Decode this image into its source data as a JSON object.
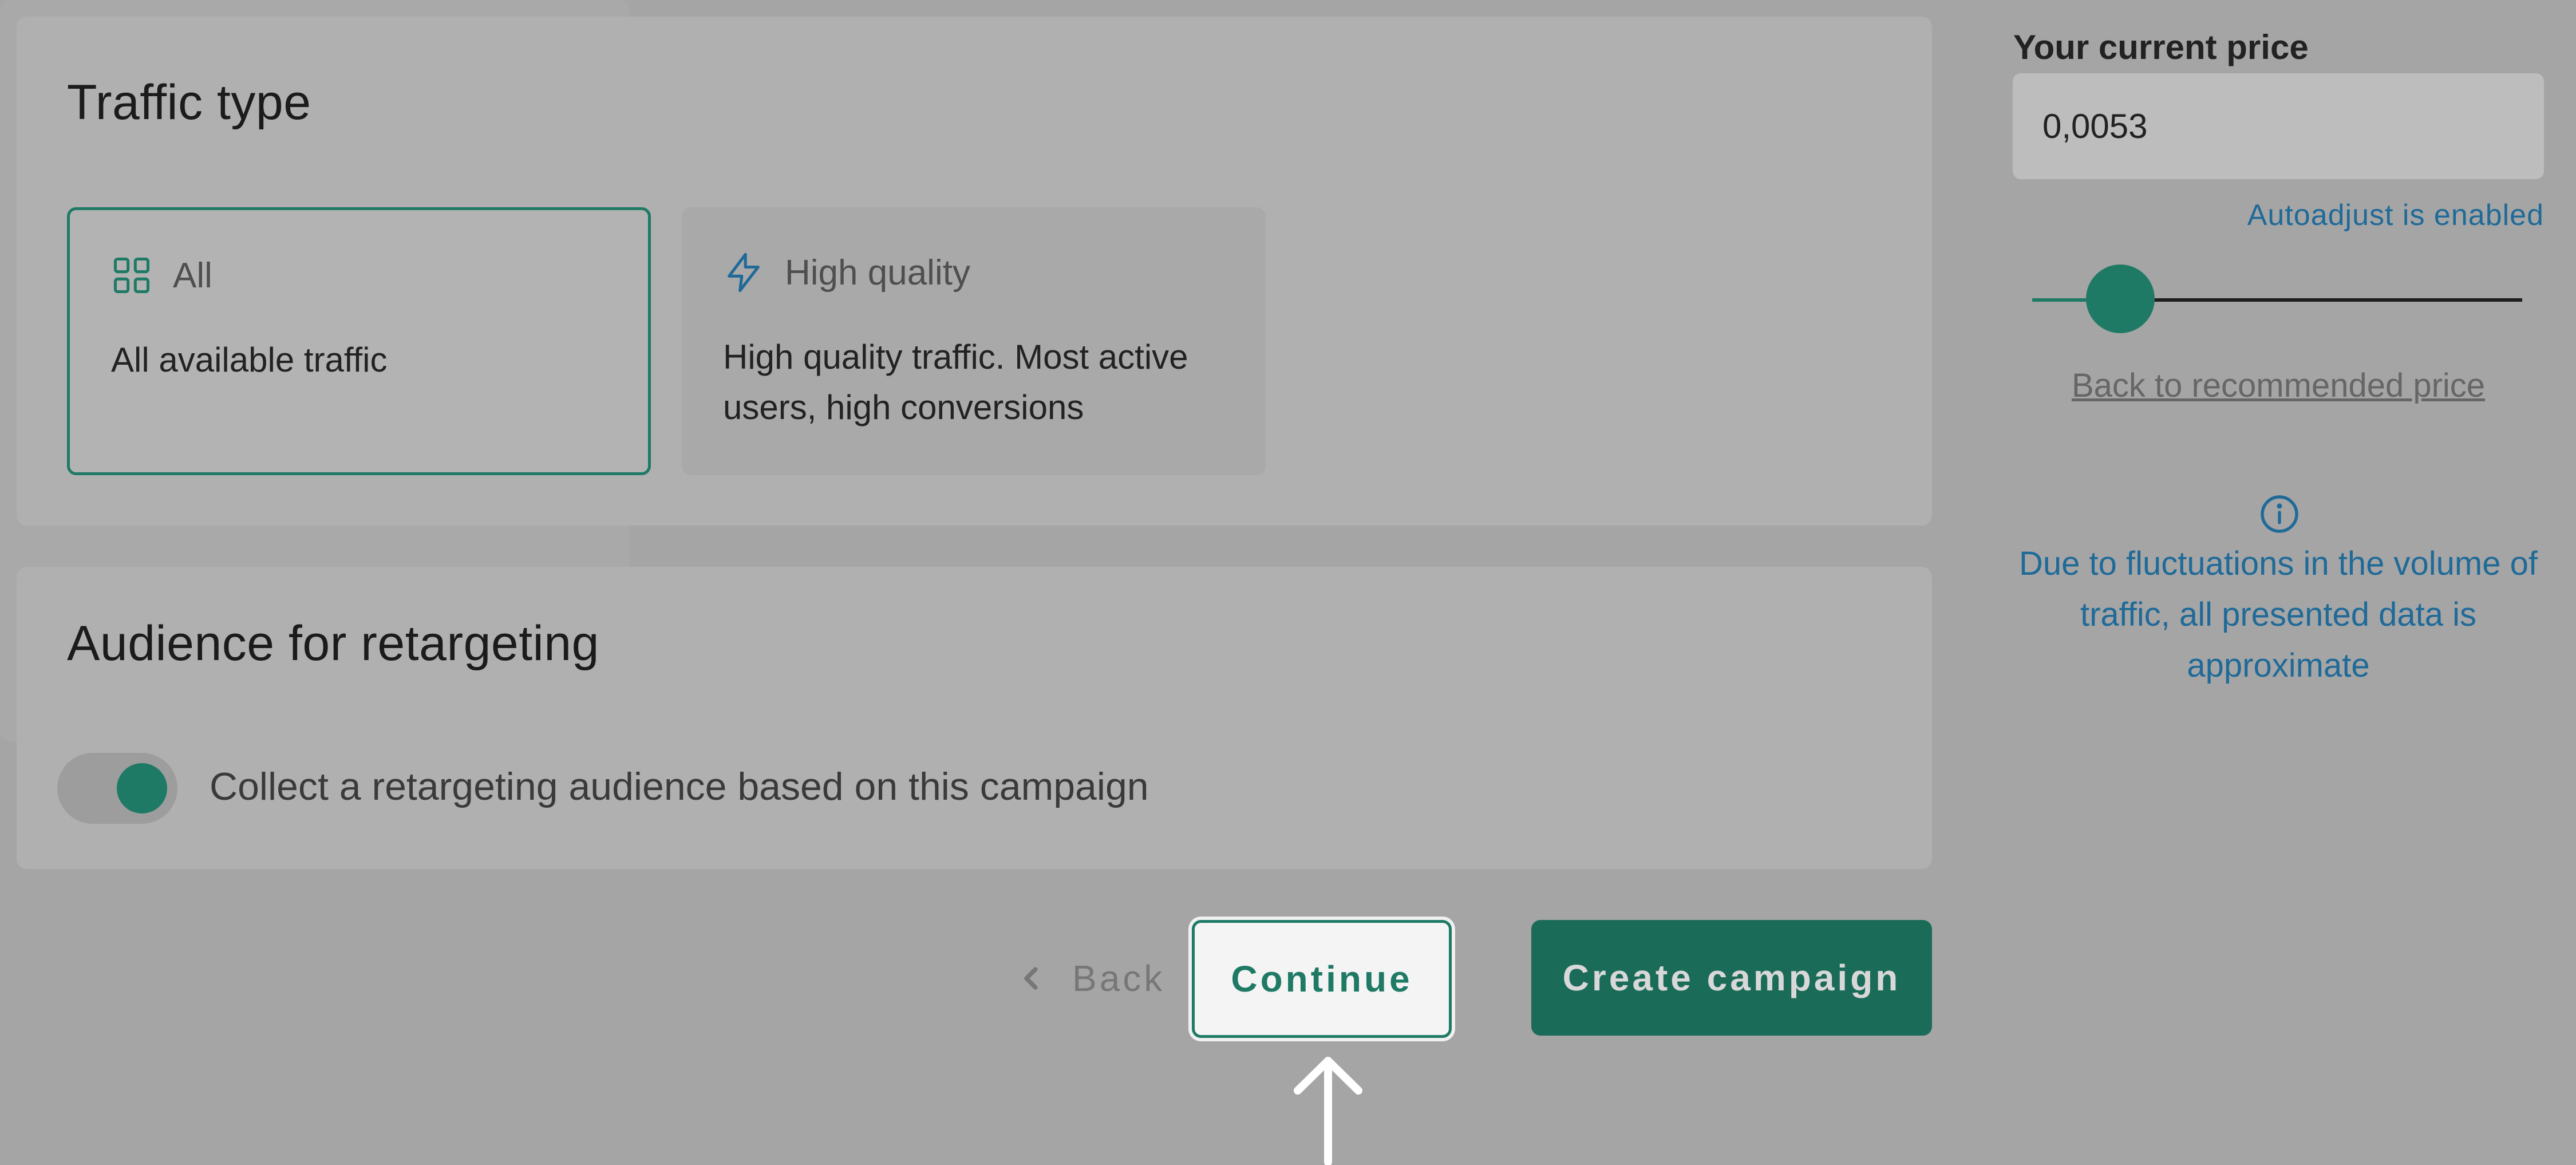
{
  "traffic": {
    "title": "Traffic type",
    "options": [
      {
        "label": "All",
        "description": "All available traffic",
        "icon": "grid-icon",
        "selected": true
      },
      {
        "label": "High quality",
        "description": "High quality traffic. Most active users, high conversions",
        "icon": "lightning-icon",
        "selected": false
      }
    ]
  },
  "audience": {
    "title": "Audience for retargeting",
    "toggle_label": "Collect a retargeting audience based on this campaign",
    "toggle_on": true
  },
  "actions": {
    "back_label": "Back",
    "continue_label": "Continue",
    "create_label": "Create campaign"
  },
  "price": {
    "label": "Your current price",
    "value": "0,0053",
    "autoadjust": "Autoadjust is enabled",
    "slider_level": 0.18,
    "back_to_recommended": "Back to recommended price",
    "info": "Due to fluctuations in the volume of traffic, all presented data is approximate"
  },
  "colors": {
    "accent": "#1f7a65",
    "link": "#1f6a98"
  }
}
